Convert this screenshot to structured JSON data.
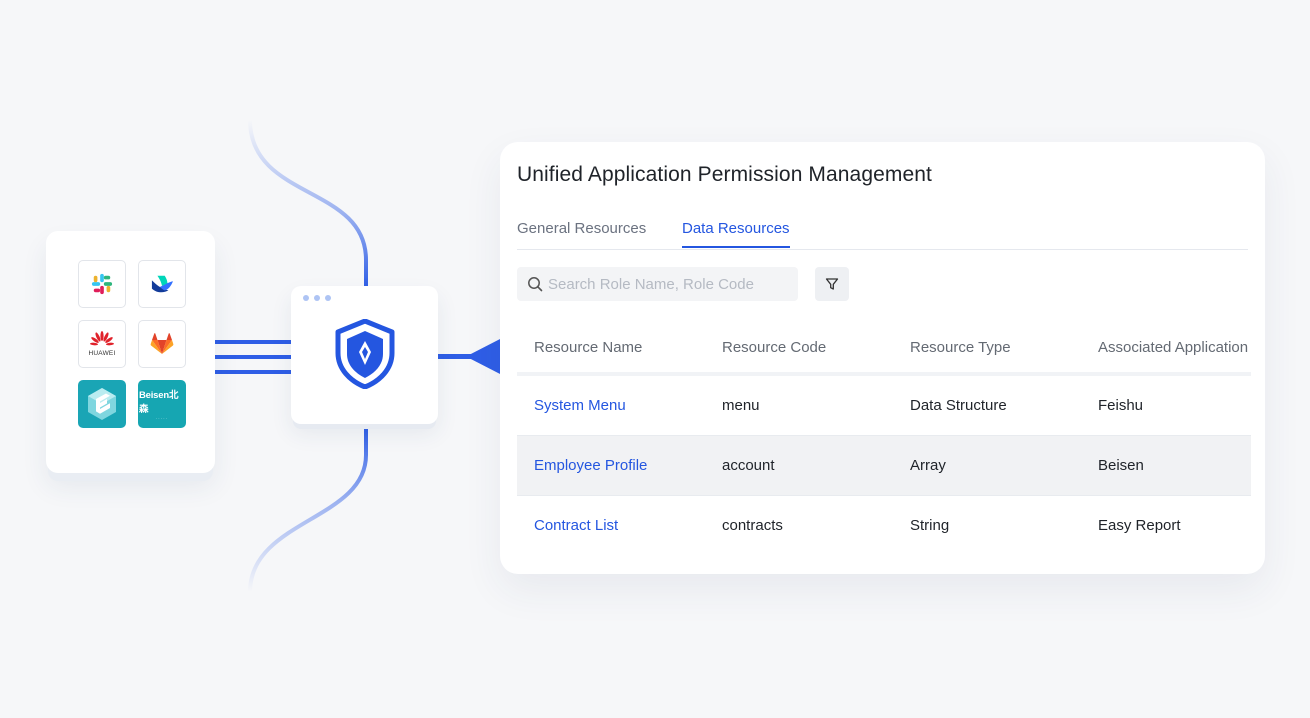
{
  "panel": {
    "title": "Unified Application Permission Management",
    "tabs": [
      {
        "label": "General Resources",
        "active": false
      },
      {
        "label": "Data Resources",
        "active": true
      }
    ],
    "search": {
      "placeholder": "Search Role Name, Role Code",
      "value": ""
    },
    "filter_icon": "filter-icon"
  },
  "table": {
    "columns": [
      "Resource Name",
      "Resource Code",
      "Resource Type",
      "Associated Application"
    ],
    "rows": [
      {
        "name": "System Menu",
        "code": "menu",
        "type": "Data Structure",
        "app": "Feishu"
      },
      {
        "name": "Employee Profile",
        "code": "account",
        "type": "Array",
        "app": "Beisen"
      },
      {
        "name": "Contract List",
        "code": "contracts",
        "type": "String",
        "app": "Easy Report"
      }
    ]
  },
  "apps": {
    "tiles": [
      {
        "name": "slack-icon"
      },
      {
        "name": "feishu-icon"
      },
      {
        "name": "huawei-icon",
        "label": "HUAWEI"
      },
      {
        "name": "gitlab-icon"
      },
      {
        "name": "easy-report-icon"
      },
      {
        "name": "beisen-icon",
        "label": "Beisen北森"
      }
    ]
  },
  "colors": {
    "accent": "#2456e0",
    "background": "#f6f7f9",
    "connector": "#2f5ee6",
    "dot": "#aec4f4",
    "teal": "#1aa5b5"
  }
}
